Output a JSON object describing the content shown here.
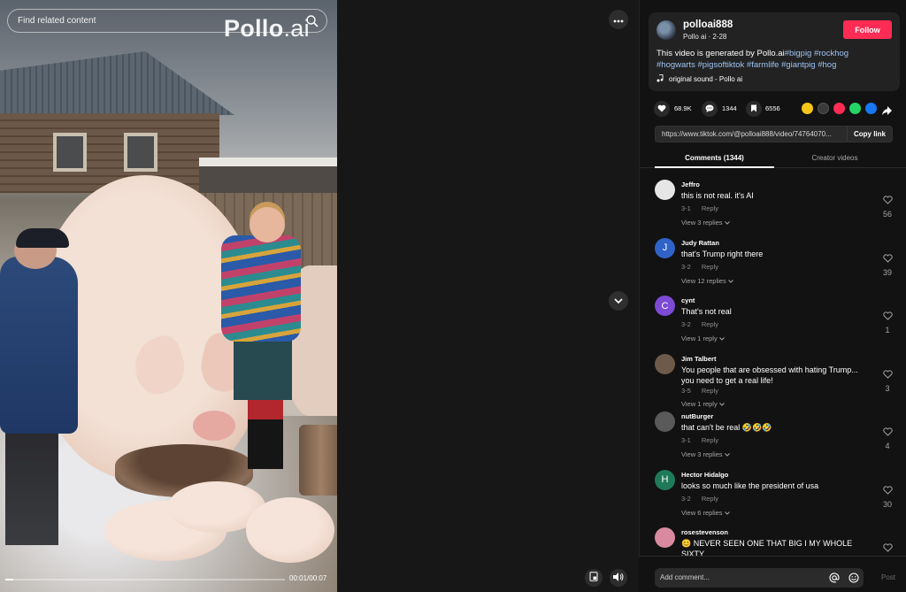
{
  "video": {
    "search_placeholder": "Find related content",
    "brand_main": "Pollo",
    "brand_suffix": ".ai",
    "time": "00:01/00:07",
    "progress": 0.03
  },
  "author": {
    "username": "polloai888",
    "subline": "Pollo ai · 2-28",
    "follow_label": "Follow"
  },
  "description": {
    "text": "This video is generated by Pollo.ai",
    "hashtags": [
      "#bigpig",
      "#rockhog",
      "#hogwarts",
      "#pigsoftiktok",
      "#farmlife",
      "#giantpig",
      "#hog"
    ]
  },
  "sound": {
    "label": "original sound - Pollo ai"
  },
  "stats": {
    "likes": "68.9K",
    "comments": "1344",
    "saves": "6556"
  },
  "share_colors": {
    "friends": "#f5c518",
    "embed": "#3a3a3a",
    "send": "#fe2c55",
    "whatsapp": "#25d366",
    "facebook": "#1877f2"
  },
  "link": {
    "url": "https://www.tiktok.com/@polloai888/video/74764070...",
    "copy_label": "Copy link"
  },
  "tabs": [
    {
      "label": "Comments (1344)",
      "active": true
    },
    {
      "label": "Creator videos",
      "active": false
    }
  ],
  "comments": [
    {
      "user": "Jeffro",
      "text": "this is not real. it's AI",
      "date": "3-1",
      "reply": "Reply",
      "likes": "56",
      "view": "View 3 replies",
      "avatar_color": "#e6e6e6",
      "avatar_letter": ""
    },
    {
      "user": "Judy Rattan",
      "text": "that's Trump right there",
      "date": "3-2",
      "reply": "Reply",
      "likes": "39",
      "view": "View 12 replies",
      "avatar_color": "#2f63c7",
      "avatar_letter": "J"
    },
    {
      "user": "cynt",
      "text": "That's not real",
      "date": "3-2",
      "reply": "Reply",
      "likes": "1",
      "view": "View 1 reply",
      "avatar_color": "#7d4ad6",
      "avatar_letter": "C"
    },
    {
      "user": "Jim Talbert",
      "text": "You people that are obsessed with hating Trump... you need to get a real life!",
      "date": "3-5",
      "reply": "Reply",
      "likes": "3",
      "view": "View 1 reply",
      "avatar_color": "#6e5a4a",
      "avatar_letter": ""
    },
    {
      "user": "nutBurger",
      "text": "that can't be real 🤣🤣🤣",
      "date": "3-1",
      "reply": "Reply",
      "likes": "4",
      "view": "View 3 replies",
      "avatar_color": "#5a5a5a",
      "avatar_letter": ""
    },
    {
      "user": "Hector Hidalgo",
      "text": "looks so much like the president of usa",
      "date": "3-2",
      "reply": "Reply",
      "likes": "30",
      "view": "View 6 replies",
      "avatar_color": "#1f7a5a",
      "avatar_letter": "H"
    },
    {
      "user": "rosestevenson",
      "text": "😊 NEVER SEEN ONE THAT BIG I MY WHOLE SIXTY",
      "date": "",
      "reply": "",
      "likes": "",
      "view": "",
      "avatar_color": "#d98aa0",
      "avatar_letter": ""
    }
  ],
  "comment_bar": {
    "placeholder": "Add comment...",
    "post_label": "Post"
  }
}
